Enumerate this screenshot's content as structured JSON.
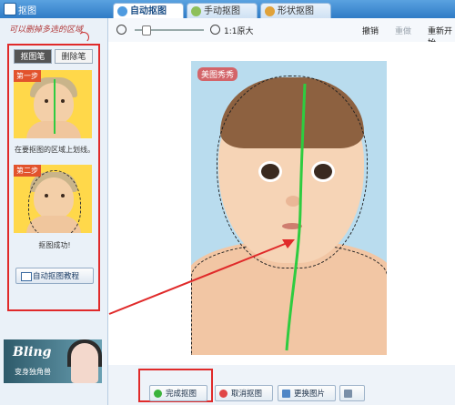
{
  "window": {
    "title": "抠图"
  },
  "tabs": [
    {
      "label": "自动抠图",
      "active": true
    },
    {
      "label": "手动抠图",
      "active": false
    },
    {
      "label": "形状抠图",
      "active": false
    }
  ],
  "left_panel": {
    "hint": "可以删掉多选的区域",
    "brush_tabs": [
      "抠图笔",
      "删除笔"
    ],
    "steps": [
      {
        "badge": "第一步",
        "caption": "在要抠图的区域上划线。"
      },
      {
        "badge": "第二步",
        "caption": "抠图成功!"
      }
    ],
    "tutorial_button": "自动抠图教程",
    "banner": {
      "title": "Bling",
      "subtitle": "变身独角兽"
    }
  },
  "toolbar": {
    "zoom_label": "1:1原大",
    "undo": "撤销",
    "redo": "重做",
    "restart": "重新开始"
  },
  "canvas": {
    "watermark": "美图秀秀"
  },
  "bottom_buttons": [
    "完成抠图",
    "取消抠图",
    "更换图片"
  ],
  "colors": {
    "accent": "#2f7bc6",
    "highlight_box": "#e02a2a",
    "stroke": "#2ecc40"
  },
  "icons": [
    "zoom-out-icon",
    "zoom-in-icon",
    "undo-icon",
    "redo-icon",
    "restart-icon",
    "check-icon",
    "cancel-icon",
    "image-icon",
    "book-icon"
  ]
}
